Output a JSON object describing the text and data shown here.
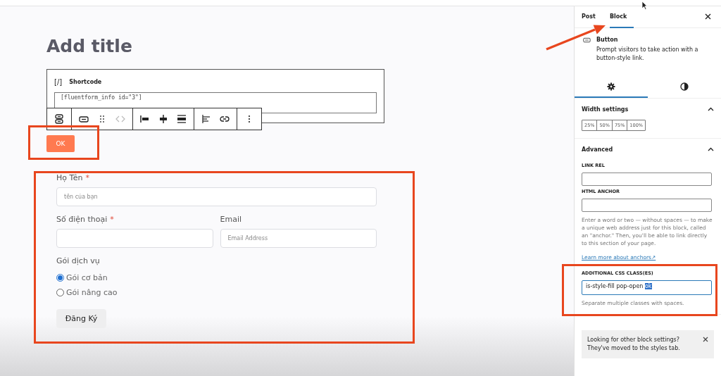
{
  "editor": {
    "title_placeholder": "Add title",
    "shortcode_block": {
      "icon_text": "[/]",
      "label": "Shortcode",
      "code": "[fluentform_info id=\"3\"]"
    },
    "ok_button": "OK",
    "form": {
      "rows": [
        [
          {
            "kind": "text",
            "label": "Họ Tên",
            "required_mark": "*",
            "placeholder": "tên của bạn"
          }
        ],
        [
          {
            "kind": "text",
            "label": "Số điện thoại",
            "required_mark": "*"
          },
          {
            "kind": "text",
            "label": "Email",
            "placeholder": "Email Address"
          }
        ],
        [
          {
            "kind": "radio",
            "label": "Gói dịch vụ",
            "options": [
              {
                "label": "Gói cơ bản",
                "selected": true
              },
              {
                "label": "Gói nâng cao",
                "selected": false
              }
            ]
          }
        ]
      ],
      "submit": "Đăng Ký"
    }
  },
  "sidebar": {
    "tabs": [
      {
        "label": "Post",
        "selected": false
      },
      {
        "label": "Block",
        "selected": true
      }
    ],
    "block": {
      "name": "Button",
      "description": "Prompt visitors to take action with a button-style link."
    },
    "subtabs": [
      {
        "kind": "settings",
        "selected": true
      },
      {
        "kind": "styles",
        "selected": false
      }
    ],
    "panels": [
      {
        "kind": "width",
        "title": "Width settings",
        "expanded": true,
        "options": [
          {
            "label": "25%",
            "selected": false
          },
          {
            "label": "50%",
            "selected": false
          },
          {
            "label": "75%",
            "selected": false
          },
          {
            "label": "100%",
            "selected": false
          }
        ]
      },
      {
        "kind": "advanced",
        "title": "Advanced",
        "expanded": true,
        "fields": [
          {
            "label": "LINK REL"
          },
          {
            "label": "HTML ANCHOR",
            "help": "Enter a word or two — without spaces — to make a unique web address just for this block, called an \"anchor.\" Then, you'll be able to link directly to this section of your page.",
            "link": "Learn more about anchors↗"
          },
          {
            "label": "ADDITIONAL CSS CLASS(ES)",
            "value": "is-style-fill pop-open ",
            "selected_text": "ok",
            "focused": true,
            "help": "Separate multiple classes with spaces."
          }
        ]
      }
    ],
    "notice": "Looking for other block settings? They've moved to the styles tab."
  }
}
